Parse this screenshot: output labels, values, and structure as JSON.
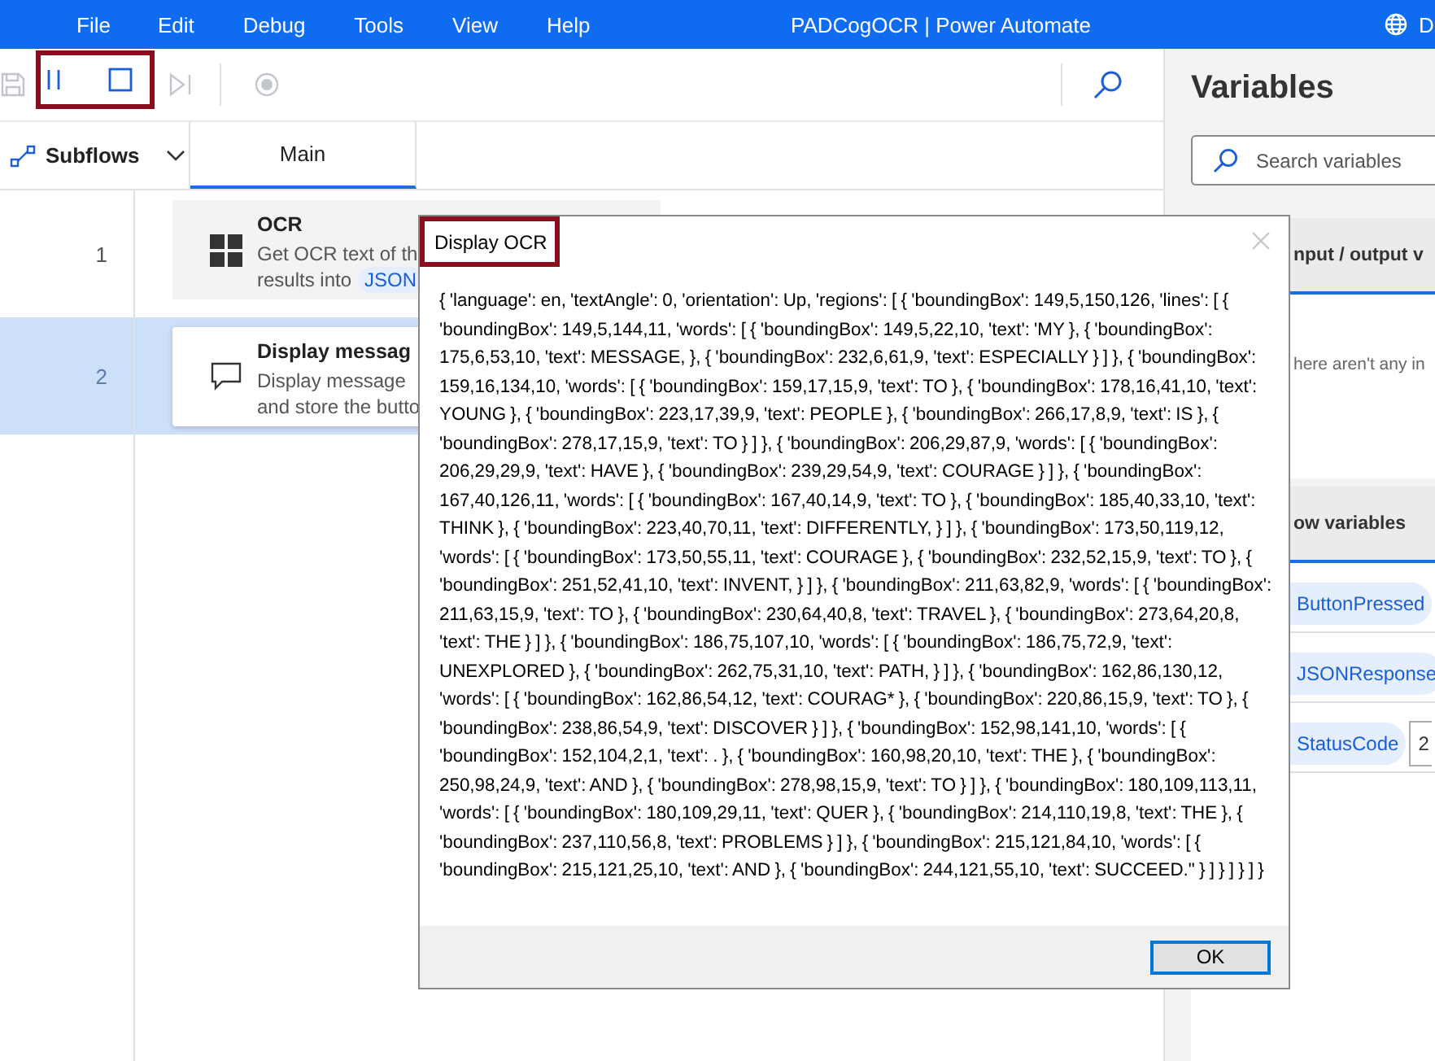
{
  "window": {
    "title": "PADCogOCR | Power Automate",
    "menu": [
      "File",
      "Edit",
      "Debug",
      "Tools",
      "View",
      "Help"
    ],
    "account": "D"
  },
  "toolbar": {
    "buttons": [
      {
        "kind": "save",
        "disabled": true
      },
      {
        "kind": "pause",
        "disabled": false
      },
      {
        "kind": "stop",
        "disabled": false
      },
      {
        "kind": "step",
        "disabled": true
      },
      {
        "kind": "record",
        "disabled": true
      }
    ]
  },
  "subflows": {
    "label": "Subflows"
  },
  "tabs": [
    {
      "label": "Main",
      "selected": true
    }
  ],
  "steps": [
    {
      "number": "1",
      "kind": "ocr",
      "selected": false,
      "title": "OCR",
      "lines": [
        "Get OCR text of th",
        "results into"
      ],
      "token": "JSON"
    },
    {
      "number": "2",
      "kind": "message",
      "selected": true,
      "title": "Display messag",
      "lines": [
        "Display message",
        "and store the butto"
      ]
    }
  ],
  "dialog": {
    "title": "Display OCR",
    "body": "{ 'language': en, 'textAngle': 0, 'orientation': Up, 'regions': [ { 'boundingBox': 149,5,150,126, 'lines': [ { 'boundingBox': 149,5,144,11, 'words': [ { 'boundingBox': 149,5,22,10, 'text': 'MY }, { 'boundingBox': 175,6,53,10, 'text': MESSAGE, }, { 'boundingBox': 232,6,61,9, 'text': ESPECIALLY } ] }, { 'boundingBox': 159,16,134,10, 'words': [ { 'boundingBox': 159,17,15,9, 'text': TO }, { 'boundingBox': 178,16,41,10, 'text': YOUNG }, { 'boundingBox': 223,17,39,9, 'text': PEOPLE }, { 'boundingBox': 266,17,8,9, 'text': IS }, { 'boundingBox': 278,17,15,9, 'text': TO } ] }, { 'boundingBox': 206,29,87,9, 'words': [ { 'boundingBox': 206,29,29,9, 'text': HAVE }, { 'boundingBox': 239,29,54,9, 'text': COURAGE } ] }, { 'boundingBox': 167,40,126,11, 'words': [ { 'boundingBox': 167,40,14,9, 'text': TO }, { 'boundingBox': 185,40,33,10, 'text': THINK }, { 'boundingBox': 223,40,70,11, 'text': DIFFERENTLY, } ] }, { 'boundingBox': 173,50,119,12, 'words': [ { 'boundingBox': 173,50,55,11, 'text': COURAGE }, { 'boundingBox': 232,52,15,9, 'text': TO }, { 'boundingBox': 251,52,41,10, 'text': INVENT, } ] }, { 'boundingBox': 211,63,82,9, 'words': [ { 'boundingBox': 211,63,15,9, 'text': TO }, { 'boundingBox': 230,64,40,8, 'text': TRAVEL }, { 'boundingBox': 273,64,20,8, 'text': THE } ] }, { 'boundingBox': 186,75,107,10, 'words': [ { 'boundingBox': 186,75,72,9, 'text': UNEXPLORED }, { 'boundingBox': 262,75,31,10, 'text': PATH, } ] }, { 'boundingBox': 162,86,130,12, 'words': [ { 'boundingBox': 162,86,54,12, 'text': COURAG* }, { 'boundingBox': 220,86,15,9, 'text': TO }, { 'boundingBox': 238,86,54,9, 'text': DISCOVER } ] }, { 'boundingBox': 152,98,141,10, 'words': [ { 'boundingBox': 152,104,2,1, 'text': . }, { 'boundingBox': 160,98,20,10, 'text': THE }, { 'boundingBox': 250,98,24,9, 'text': AND }, { 'boundingBox': 278,98,15,9, 'text': TO } ] }, { 'boundingBox': 180,109,113,11, 'words': [ { 'boundingBox': 180,109,29,11, 'text': QUER }, { 'boundingBox': 214,110,19,8, 'text': THE }, { 'boundingBox': 237,110,56,8, 'text': PROBLEMS } ] }, { 'boundingBox': 215,121,84,10, 'words': [ { 'boundingBox': 215,121,25,10, 'text': AND }, { 'boundingBox': 244,121,55,10, 'text': SUCCEED.\" } ] } ] } ] }",
    "button": "OK"
  },
  "variables": {
    "title": "Variables",
    "search": {
      "placeholder": "Search variables"
    },
    "io_header": "nput / output v",
    "io_empty": "here aren't any in",
    "flow_header": "ow variables",
    "items": [
      {
        "name": "ButtonPressed"
      },
      {
        "name": "JSONResponse"
      },
      {
        "name": "StatusCode",
        "value": "2"
      }
    ]
  }
}
